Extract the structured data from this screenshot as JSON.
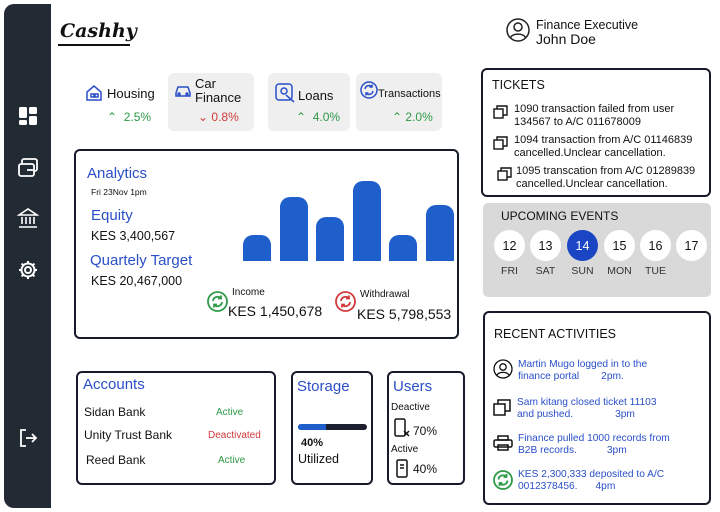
{
  "app": {
    "logo": "Cashhy"
  },
  "user": {
    "role": "Finance Executive",
    "name": "John Doe"
  },
  "sidebar": {
    "items": [
      "dashboard-icon",
      "wallet-icon",
      "bank-icon",
      "settings-icon",
      "logout-icon"
    ]
  },
  "stats": [
    {
      "label": "Housing",
      "value": "2.5%",
      "trend": "up",
      "icon": "house-icon"
    },
    {
      "label": "Car Finance",
      "value": "0.8%",
      "trend": "down",
      "icon": "car-icon"
    },
    {
      "label": "Loans",
      "value": "4.0%",
      "trend": "up",
      "icon": "loan-icon"
    },
    {
      "label": "Transactions",
      "value": "2.0%",
      "trend": "up",
      "icon": "transactions-icon"
    }
  ],
  "analytics": {
    "title": "Analytics",
    "date": "Fri 23Nov 1pm",
    "equity_label": "Equity",
    "equity_value": "KES 3,400,567",
    "target_label": "Quartely Target",
    "target_value": "KES 20,467,000",
    "income_label": "Income",
    "income_value": "KES 1,450,678",
    "withdrawal_label": "Withdrawal",
    "withdrawal_value": "KES 5,798,553"
  },
  "chart_data": {
    "type": "bar",
    "values": [
      26,
      64,
      44,
      80,
      26,
      56
    ],
    "ylim": [
      0,
      80
    ],
    "color": "#1f5fcc"
  },
  "tickets": {
    "title": "TICKETS",
    "items": [
      {
        "line1": "1090 transaction failed from  user",
        "line2": "134567 to A/C 011678009"
      },
      {
        "line1": "1094 transaction  from A/C 01146839",
        "line2": "cancelled.Unclear cancellation."
      },
      {
        "line1": "1095 transcation from A/C 01289839",
        "line2": "cancelled.Unclear cancellation."
      }
    ]
  },
  "events": {
    "title": "UPCOMING EVENTS",
    "days": [
      {
        "num": "12",
        "wd": "FRI"
      },
      {
        "num": "13",
        "wd": "SAT"
      },
      {
        "num": "14",
        "wd": "SUN",
        "active": true
      },
      {
        "num": "15",
        "wd": "MON"
      },
      {
        "num": "16",
        "wd": "TUE"
      },
      {
        "num": "17",
        "wd": ""
      }
    ]
  },
  "activities": {
    "title": "RECENT ACTIVITIES",
    "items": [
      {
        "line1": "Martin Mugo logged in to the",
        "line2": "finance portal",
        "time": "2pm."
      },
      {
        "line1": "Sam kitang closed ticket 11103",
        "line2": "and pushed.",
        "time": "3pm"
      },
      {
        "line1": "Finance pulled 1000 records from",
        "line2": "B2B records.",
        "time": "3pm"
      },
      {
        "line1": "KES 2,300,333 deposited to A/C",
        "line2": "0012378456.",
        "time": "4pm"
      }
    ]
  },
  "accounts": {
    "title": "Accounts",
    "rows": [
      {
        "name": "Sidan Bank",
        "status": "Active"
      },
      {
        "name": "Unity Trust Bank",
        "status": "Deactivated"
      },
      {
        "name": "Reed Bank",
        "status": "Active"
      }
    ]
  },
  "storage": {
    "title": "Storage",
    "percent": "40%",
    "label": "Utilized",
    "fraction": 0.4
  },
  "users": {
    "title": "Users",
    "deactive_label": "Deactive",
    "deactive_value": "70%",
    "active_label": "Active",
    "active_value": "40%"
  },
  "colors": {
    "sidebar": "#222a33",
    "accent": "#1a46c4",
    "up": "#2e9a48",
    "down": "#d13a3a",
    "bar": "#1f5fcc"
  }
}
